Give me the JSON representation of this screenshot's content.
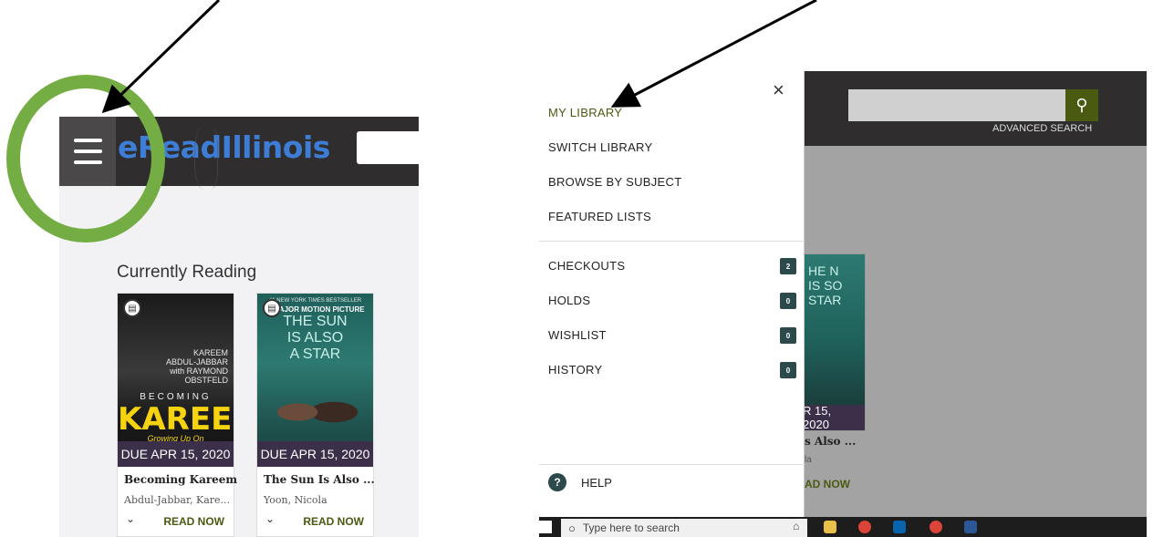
{
  "left_screen": {
    "logo": "eReadIllinois",
    "section_title": "Currently Reading",
    "books": [
      {
        "cover_author": "KAREEM ABDUL-JABBAR with RAYMOND OBSTFELD",
        "cover_kicker": "BECOMING",
        "cover_title": "KAREEM",
        "cover_subtitle": "Growing Up On",
        "due": "DUE APR 15, 2020",
        "title": "Becoming Kareem",
        "author": "Abdul-Jabbar, Kare...",
        "action": "READ NOW"
      },
      {
        "cover_top": "#1 NEW YORK TIMES BESTSELLER",
        "cover_kicker": "A MAJOR MOTION PICTURE",
        "cover_title": "THE SUN IS ALSO A STAR",
        "due": "DUE APR 15, 2020",
        "title": "The Sun Is Also ...",
        "author": "Yoon, Nicola",
        "action": "READ NOW"
      }
    ]
  },
  "right_screen": {
    "advanced_search": "ADVANCED SEARCH",
    "close_symbol": "×",
    "menu_primary": [
      {
        "label": "MY LIBRARY",
        "active": true
      },
      {
        "label": "SWITCH LIBRARY",
        "active": false
      },
      {
        "label": "BROWSE BY SUBJECT",
        "active": false
      },
      {
        "label": "FEATURED LISTS",
        "active": false
      }
    ],
    "menu_secondary": [
      {
        "label": "CHECKOUTS",
        "count": "2"
      },
      {
        "label": "HOLDS",
        "count": "0"
      },
      {
        "label": "WISHLIST",
        "count": "0"
      },
      {
        "label": "HISTORY",
        "count": "0"
      }
    ],
    "help_label": "HELP",
    "bg_book": {
      "cover_title": "HE N IS SO STAR",
      "due": "R 15, 2020",
      "title": "s Also ...",
      "author": "la",
      "action": "AD NOW"
    },
    "taskbar_search_placeholder": "Type here to search"
  },
  "colors": {
    "header_dark": "#2f2d2e",
    "accent_olive": "#4a5a10",
    "count_badge": "#2c4a4c",
    "green_ring": "#74ad43",
    "due_bar": "#3b2f4a",
    "logo_blue": "#3d7dd6"
  },
  "icons": {
    "menu": "hamburger-menu-icon",
    "search": "search-icon",
    "close": "close-icon",
    "help": "question-mark-icon",
    "ebook": "open-book-icon"
  }
}
